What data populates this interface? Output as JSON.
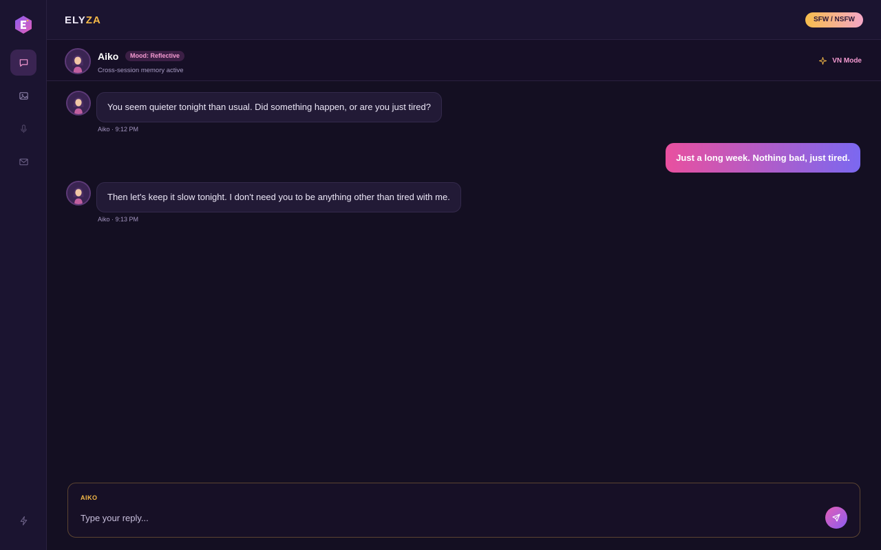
{
  "brand": {
    "part1": "ELY",
    "part2": "ZA"
  },
  "header": {
    "mode_pill": "SFW / NSFW"
  },
  "sidebar": {
    "items": [
      {
        "icon": "chat-icon",
        "active": true
      },
      {
        "icon": "image-icon",
        "active": false
      },
      {
        "icon": "microphone-icon",
        "active": false
      },
      {
        "icon": "mail-icon",
        "active": false
      }
    ],
    "bottom_icon": "lightning-icon"
  },
  "character": {
    "name": "Aiko",
    "mood": "Mood: Reflective",
    "subtitle": "Cross-session memory active",
    "vn_mode": "VN Mode"
  },
  "messages": [
    {
      "sender": "ai",
      "text": "You seem quieter tonight than usual. Did something happen, or are you just tired?",
      "meta": "Aiko · 9:12 PM"
    },
    {
      "sender": "user",
      "text": "Just a long week. Nothing bad, just tired."
    },
    {
      "sender": "ai",
      "text": "Then let's keep it slow tonight. I don't need you to be anything other than tired with me.",
      "meta": "Aiko · 9:13 PM"
    }
  ],
  "composer": {
    "label": "AIKO",
    "placeholder": "Type your reply..."
  },
  "colors": {
    "background": "#140f22",
    "accent_gold": "#f5b947",
    "accent_pink": "#f49ad1",
    "user_bubble_start": "#e9509f",
    "user_bubble_end": "#7b68f0"
  }
}
